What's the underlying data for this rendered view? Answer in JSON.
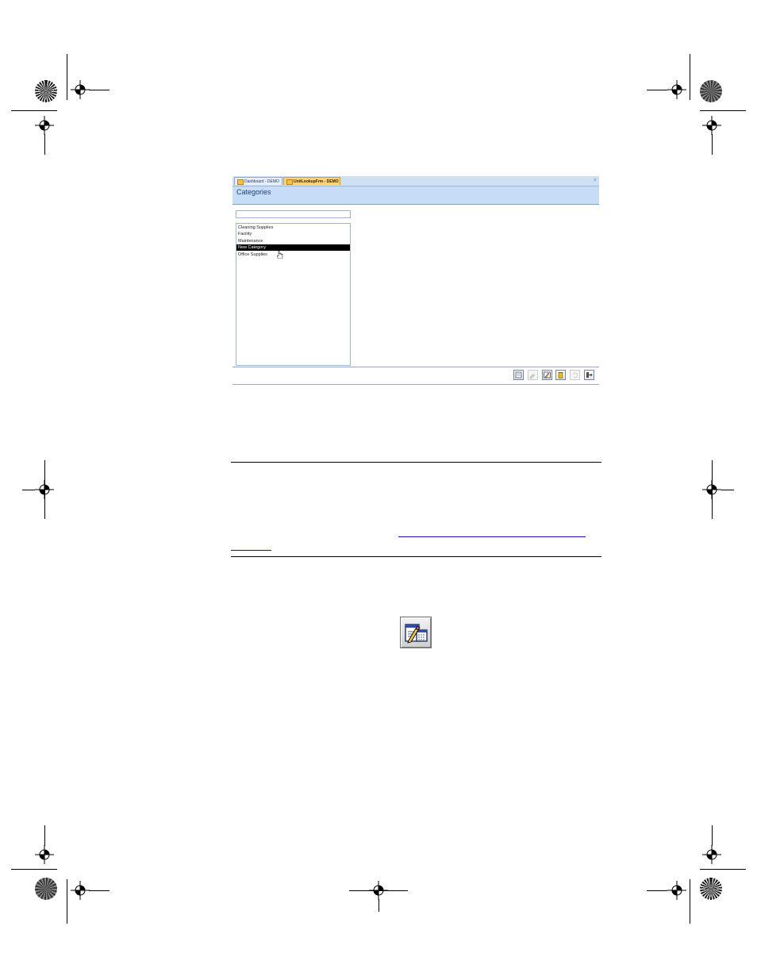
{
  "window": {
    "tabs": [
      {
        "label": "Dashboard - DEMO",
        "active": false
      },
      {
        "label": "UnitLookupFrm - DEMO",
        "active": true
      }
    ],
    "close_glyph": "×",
    "form_title": "Categories",
    "search_value": "",
    "list_items": [
      {
        "label": "Cleaning Supplies",
        "selected": false
      },
      {
        "label": "Facility",
        "selected": false
      },
      {
        "label": "Maintenance",
        "selected": false
      },
      {
        "label": "New Category",
        "selected": true
      },
      {
        "label": "Office Supplies",
        "selected": false
      }
    ],
    "toolbar": [
      {
        "name": "new-record-button",
        "icon": "new-record-icon",
        "enabled": true
      },
      {
        "name": "save-button",
        "icon": "save-icon",
        "enabled": false
      },
      {
        "name": "edit-button",
        "icon": "edit-icon",
        "enabled": true
      },
      {
        "name": "delete-button",
        "icon": "trash-icon",
        "enabled": true
      },
      {
        "name": "undo-button",
        "icon": "undo-icon",
        "enabled": false
      },
      {
        "name": "close-form-button",
        "icon": "exit-icon",
        "enabled": true
      }
    ]
  },
  "colors": {
    "tabstrip": "#cfe0f4",
    "active_tab": "#fbd27a",
    "header": "#c7dcf6",
    "title_text": "#1f3e78",
    "selection": "#000000",
    "link": "#1a0dab"
  },
  "note": {
    "link_line1": "",
    "link_line2": ""
  },
  "figure_icon": "edit-form-icon"
}
